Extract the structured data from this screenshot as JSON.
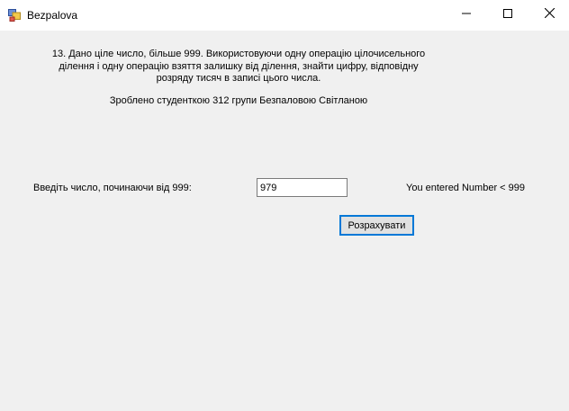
{
  "window": {
    "title": "Bezpalova",
    "controls": {
      "minimize_icon": "minimize-icon",
      "maximize_icon": "maximize-icon",
      "close_icon": "close-icon"
    }
  },
  "form": {
    "description_lines": [
      "13. Дано ціле число, більше 999. Використовуючи одну операцію цілочисельного",
      "ділення і одну операцію взяття залишку від ділення, знайти цифру, відповідну",
      "розряду тисяч в записі цього числа."
    ],
    "credit": "Зроблено студенткою 312 групи Безпаловою Світланою",
    "prompt_label": "Введіть число, починаючи від 999:",
    "number_value": "979",
    "result_text": "You entered Number < 999",
    "calculate_button": "Розрахувати"
  },
  "colors": {
    "background": "#f0f0f0",
    "titlebar": "#ffffff",
    "button_focus_border": "#0078d7",
    "button_face": "#e1e1e1"
  }
}
